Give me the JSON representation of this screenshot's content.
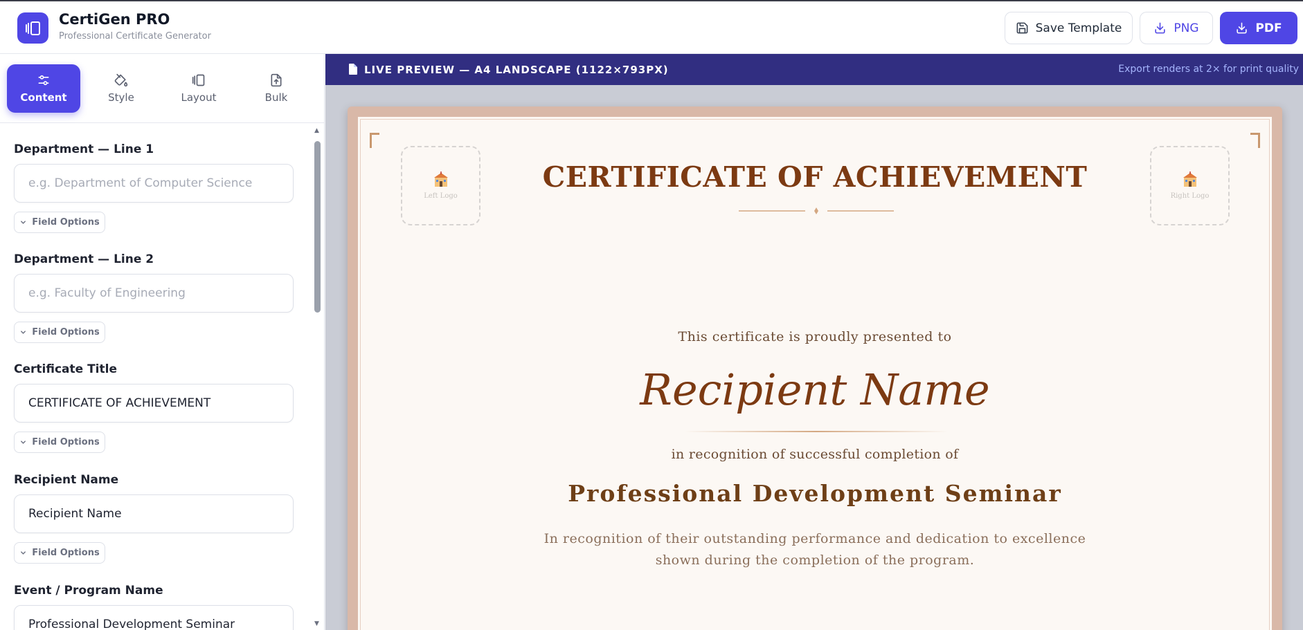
{
  "app": {
    "title": "CertiGen PRO",
    "subtitle": "Professional Certificate Generator"
  },
  "header": {
    "save_label": "Save Template",
    "png_label": "PNG",
    "pdf_label": "PDF"
  },
  "tabs": [
    {
      "label": "Content",
      "icon": "sliders-icon",
      "active": true
    },
    {
      "label": "Style",
      "icon": "paint-bucket-icon",
      "active": false
    },
    {
      "label": "Layout",
      "icon": "layout-icon",
      "active": false
    },
    {
      "label": "Bulk",
      "icon": "file-upload-icon",
      "active": false
    }
  ],
  "fields": [
    {
      "label": "Department — Line 1",
      "value": "",
      "placeholder": "e.g. Department of Computer Science",
      "options_label": "Field Options"
    },
    {
      "label": "Department — Line 2",
      "value": "",
      "placeholder": "e.g. Faculty of Engineering",
      "options_label": "Field Options"
    },
    {
      "label": "Certificate Title",
      "value": "CERTIFICATE OF ACHIEVEMENT",
      "placeholder": "",
      "options_label": "Field Options"
    },
    {
      "label": "Recipient Name",
      "value": "Recipient Name",
      "placeholder": "",
      "options_label": "Field Options"
    },
    {
      "label": "Event / Program Name",
      "value": "Professional Development Seminar",
      "placeholder": "",
      "options_label": ""
    }
  ],
  "preview": {
    "title": "LIVE PREVIEW — A4 LANDSCAPE (1122×793PX)",
    "note": "Export renders at 2× for print quality"
  },
  "certificate": {
    "left_logo": "Left Logo",
    "right_logo": "Right Logo",
    "title": "CERTIFICATE OF ACHIEVEMENT",
    "presented": "This certificate is proudly presented to",
    "recipient": "Recipient Name",
    "recognition": "in recognition of successful completion of",
    "event": "Professional Development Seminar",
    "description": "In recognition of their outstanding performance and dedication to excellence shown during the completion of the program."
  },
  "colors": {
    "accent": "#4f46e5",
    "preview_bar": "#312e81",
    "cert_title": "#7c3a12",
    "cert_border": "#d9b8a8"
  }
}
